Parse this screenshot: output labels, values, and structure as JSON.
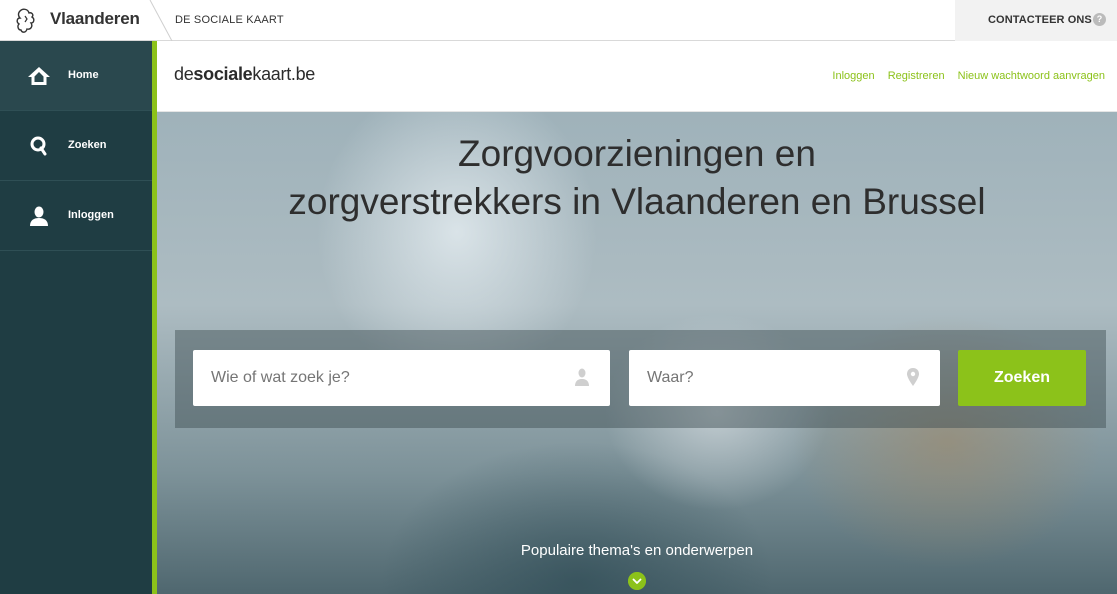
{
  "topbar": {
    "region": "Vlaanderen",
    "site": "DE SOCIALE KAART",
    "contact": "CONTACTEER ONS",
    "contact_icon": "help-icon"
  },
  "sidebar": {
    "items": [
      {
        "label": "Home",
        "icon": "home-icon"
      },
      {
        "label": "Zoeken",
        "icon": "search-icon"
      },
      {
        "label": "Inloggen",
        "icon": "user-icon"
      }
    ]
  },
  "header": {
    "brand_prefix": "de",
    "brand_bold": "sociale",
    "brand_suffix": "kaart.be",
    "links": [
      "Inloggen",
      "Registreren",
      "Nieuw wachtwoord aanvragen"
    ]
  },
  "hero": {
    "title_line1": "Zorgvoorzieningen en",
    "title_line2": "zorgverstrekkers in Vlaanderen en Brussel",
    "who_placeholder": "Wie of wat zoek je?",
    "where_placeholder": "Waar?",
    "search_button": "Zoeken",
    "popular": "Populaire thema's en onderwerpen"
  },
  "colors": {
    "accent": "#8cc21a",
    "sidebar": "#1f3d43"
  }
}
